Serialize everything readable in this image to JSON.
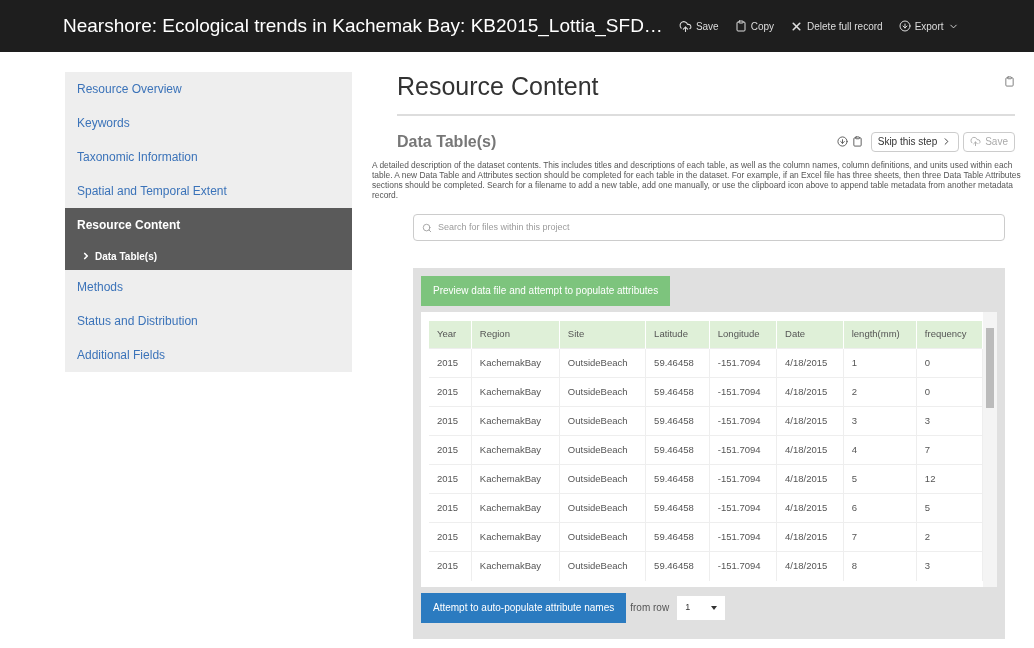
{
  "header": {
    "title": "Nearshore: Ecological trends in Kachemak Bay: KB2015_Lottia_SFD…",
    "actions": [
      {
        "kind": "save",
        "label": "Save"
      },
      {
        "kind": "copy",
        "label": "Copy"
      },
      {
        "kind": "delete",
        "label": "Delete full record"
      },
      {
        "kind": "export",
        "label": "Export"
      }
    ]
  },
  "sidebar": {
    "items": [
      {
        "label": "Resource Overview",
        "selected": false
      },
      {
        "label": "Keywords",
        "selected": false
      },
      {
        "label": "Taxonomic Information",
        "selected": false
      },
      {
        "label": "Spatial and Temporal Extent",
        "selected": false
      },
      {
        "label": "Resource Content",
        "selected": true,
        "children": [
          {
            "label": "Data Table(s)",
            "selected": true
          }
        ]
      },
      {
        "label": "Methods",
        "selected": false
      },
      {
        "label": "Status and Distribution",
        "selected": false
      },
      {
        "label": "Additional Fields",
        "selected": false
      }
    ]
  },
  "page": {
    "title": "Resource Content",
    "section_title": "Data Table(s)",
    "skip_button": "Skip this step",
    "save_button": "Save",
    "save_disabled": true,
    "description": "A detailed description of the dataset contents. This includes titles and descriptions of each table, as well as the column names, column definitions, and units used within each table. A new Data Table and Attributes section should be completed for each table in the dataset. For example, if an Excel file has three sheets, then three Data Table Attributes sections should be completed. Search for a filename to add a new table, add one manually, or use the clipboard icon above to append table metadata from another metadata record.",
    "search": {
      "placeholder": "Search for files within this project"
    },
    "preview_button": "Preview data file and attempt to populate attributes",
    "table": {
      "columns": [
        "Year",
        "Region",
        "Site",
        "Latitude",
        "Longitude",
        "Date",
        "length(mm)",
        "frequency"
      ],
      "rows": [
        [
          "2015",
          "KachemakBay",
          "OutsideBeach",
          "59.46458",
          "-151.7094",
          "4/18/2015",
          "1",
          "0"
        ],
        [
          "2015",
          "KachemakBay",
          "OutsideBeach",
          "59.46458",
          "-151.7094",
          "4/18/2015",
          "2",
          "0"
        ],
        [
          "2015",
          "KachemakBay",
          "OutsideBeach",
          "59.46458",
          "-151.7094",
          "4/18/2015",
          "3",
          "3"
        ],
        [
          "2015",
          "KachemakBay",
          "OutsideBeach",
          "59.46458",
          "-151.7094",
          "4/18/2015",
          "4",
          "7"
        ],
        [
          "2015",
          "KachemakBay",
          "OutsideBeach",
          "59.46458",
          "-151.7094",
          "4/18/2015",
          "5",
          "12"
        ],
        [
          "2015",
          "KachemakBay",
          "OutsideBeach",
          "59.46458",
          "-151.7094",
          "4/18/2015",
          "6",
          "5"
        ],
        [
          "2015",
          "KachemakBay",
          "OutsideBeach",
          "59.46458",
          "-151.7094",
          "4/18/2015",
          "7",
          "2"
        ],
        [
          "2015",
          "KachemakBay",
          "OutsideBeach",
          "59.46458",
          "-151.7094",
          "4/18/2015",
          "8",
          "3"
        ]
      ]
    },
    "auto_button": "Attempt to auto-populate attribute names",
    "from_row_label": "from row",
    "from_row_value": "1"
  }
}
